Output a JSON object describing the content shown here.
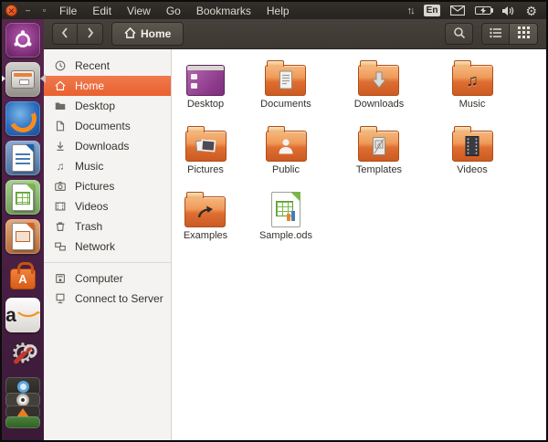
{
  "window": {
    "controls": [
      {
        "name": "close",
        "glyph": "✕"
      },
      {
        "name": "minimize",
        "glyph": "–"
      },
      {
        "name": "maximize",
        "glyph": "▫"
      }
    ]
  },
  "menu_bar": {
    "items": [
      "File",
      "Edit",
      "View",
      "Go",
      "Bookmarks",
      "Help"
    ],
    "tray": [
      {
        "icon": "network-arrows-icon"
      },
      {
        "icon": "keyboard-indicator",
        "label": "En"
      },
      {
        "icon": "mail-icon"
      },
      {
        "icon": "battery-icon"
      },
      {
        "icon": "volume-icon"
      },
      {
        "icon": "session-gear-icon"
      }
    ]
  },
  "toolbar": {
    "breadcrumb": {
      "label": "Home",
      "icon": "home-icon"
    },
    "buttons": [
      {
        "name": "back",
        "icon": "chevron-left-icon"
      },
      {
        "name": "forward",
        "icon": "chevron-right-icon"
      },
      {
        "name": "search",
        "icon": "search-icon"
      },
      {
        "name": "list-view",
        "icon": "list-view-icon",
        "active": false
      },
      {
        "name": "grid-view",
        "icon": "grid-view-icon",
        "active": true
      }
    ]
  },
  "dock": {
    "items": [
      {
        "name": "ubuntu-dash",
        "icon": "ubuntu-logo-icon",
        "active": false
      },
      {
        "name": "file-manager",
        "icon": "file-cabinet-icon",
        "active": true
      },
      {
        "name": "firefox",
        "icon": "firefox-icon",
        "active": false
      },
      {
        "name": "libreoffice-writer",
        "icon": "writer-doc-icon",
        "active": false
      },
      {
        "name": "libreoffice-calc",
        "icon": "calc-doc-icon",
        "active": false
      },
      {
        "name": "libreoffice-impress",
        "icon": "impress-doc-icon",
        "active": false
      },
      {
        "name": "software-center",
        "icon": "shopping-bag-icon",
        "active": false
      },
      {
        "name": "amazon",
        "icon": "amazon-a-icon",
        "active": false
      },
      {
        "name": "system-settings",
        "icon": "gear-wrench-icon",
        "active": false
      }
    ],
    "stacked_items": [
      {
        "name": "stacked-app-blue",
        "icon": "blue-ring-icon"
      },
      {
        "name": "stacked-app-disc",
        "icon": "disc-icon"
      },
      {
        "name": "stacked-app-vlc",
        "icon": "vlc-cone-icon"
      },
      {
        "name": "stacked-app-green",
        "icon": "green-strip-icon"
      }
    ]
  },
  "sidebar": {
    "primary": [
      {
        "label": "Recent",
        "icon": "recent-clock-icon",
        "selected": false
      },
      {
        "label": "Home",
        "icon": "home-icon",
        "selected": true
      },
      {
        "label": "Desktop",
        "icon": "folder-icon",
        "selected": false
      },
      {
        "label": "Documents",
        "icon": "document-icon",
        "selected": false
      },
      {
        "label": "Downloads",
        "icon": "download-arrow-icon",
        "selected": false
      },
      {
        "label": "Music",
        "icon": "music-note-icon",
        "selected": false
      },
      {
        "label": "Pictures",
        "icon": "camera-icon",
        "selected": false
      },
      {
        "label": "Videos",
        "icon": "video-icon",
        "selected": false
      },
      {
        "label": "Trash",
        "icon": "trash-icon",
        "selected": false
      },
      {
        "label": "Network",
        "icon": "network-icon",
        "selected": false
      }
    ],
    "secondary": [
      {
        "label": "Computer",
        "icon": "computer-drive-icon",
        "selected": false
      },
      {
        "label": "Connect to Server",
        "icon": "server-monitor-icon",
        "selected": false
      }
    ]
  },
  "files": {
    "items": [
      {
        "label": "Desktop",
        "icon": "desktop-screen"
      },
      {
        "label": "Documents",
        "icon": "folder-documents"
      },
      {
        "label": "Downloads",
        "icon": "folder-downloads"
      },
      {
        "label": "Music",
        "icon": "folder-music"
      },
      {
        "label": "Pictures",
        "icon": "folder-pictures"
      },
      {
        "label": "Public",
        "icon": "folder-public"
      },
      {
        "label": "Templates",
        "icon": "folder-templates"
      },
      {
        "label": "Videos",
        "icon": "folder-videos"
      },
      {
        "label": "Examples",
        "icon": "folder-examples"
      },
      {
        "label": "Sample.ods",
        "icon": "calc-spreadsheet"
      }
    ]
  },
  "colors": {
    "selection_orange": "#ec6b3e",
    "ubuntu_close_orange": "#d4410f",
    "panel_dark": "#2b2824",
    "toolbar_dark": "#413d37",
    "dock_purple": "#4e2247",
    "sidebar_bg": "#f5f3f1",
    "folder_orange": "#de6e32",
    "calc_green": "#7ab648",
    "desktop_purple": "#8d3a8a"
  }
}
